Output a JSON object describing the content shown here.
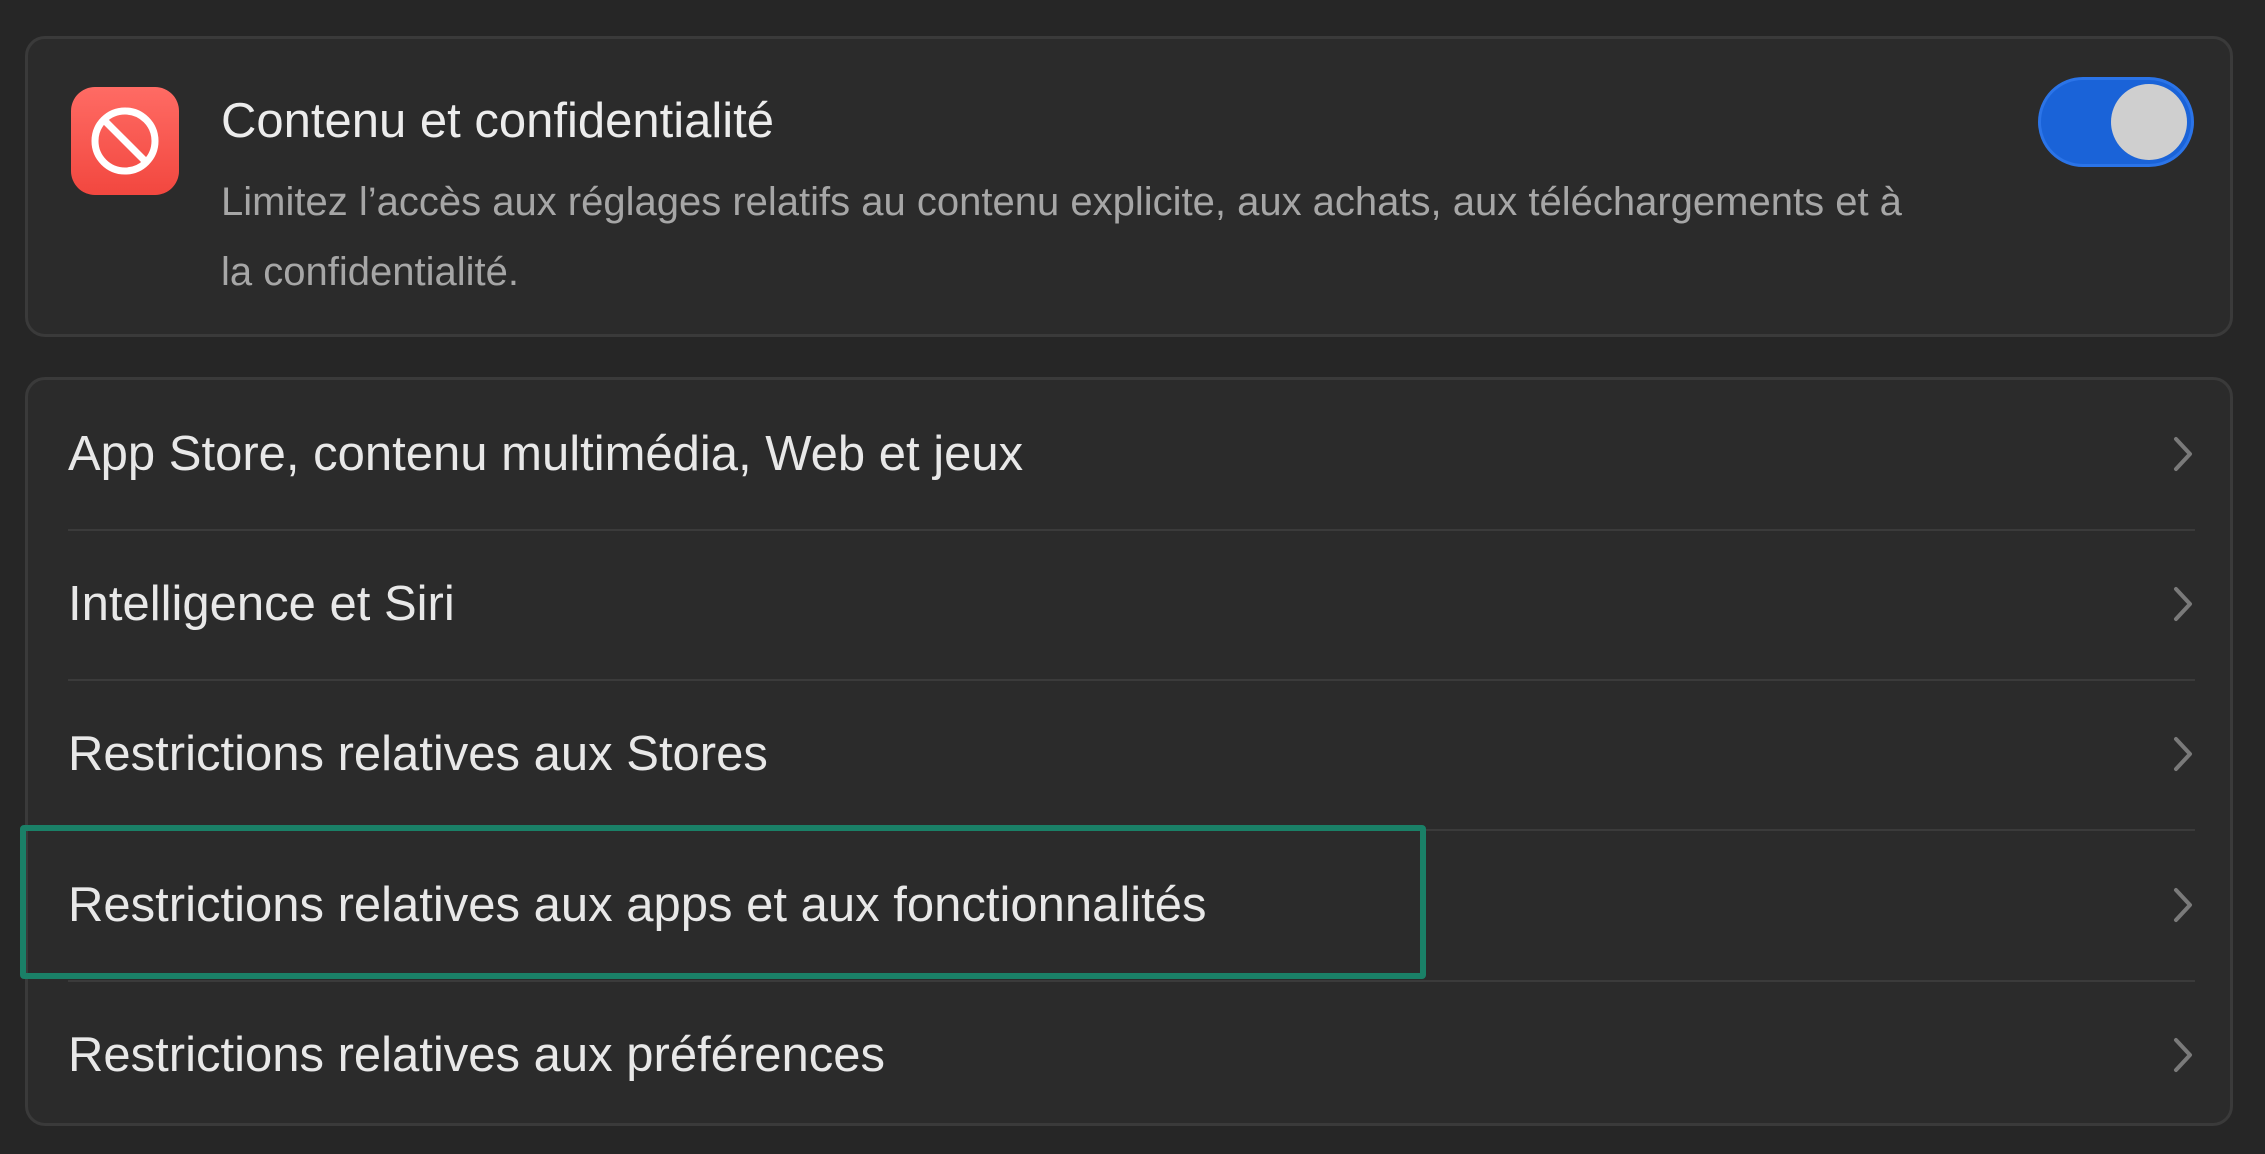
{
  "content_privacy": {
    "icon": "restricted-icon",
    "title": "Contenu et confidentialité",
    "description": "Limitez l’accès aux réglages relatifs au contenu explicite, aux achats, aux téléchargements et à la confidentialité.",
    "toggle_on": true,
    "toggle_color": "#1a63d8",
    "icon_color": "#f2473f"
  },
  "menu": {
    "items": [
      {
        "label": "App Store, contenu multimédia, Web et jeux"
      },
      {
        "label": "Intelligence et Siri"
      },
      {
        "label": "Restrictions relatives aux Stores"
      },
      {
        "label": "Restrictions relatives aux apps et aux fonctionnalités"
      },
      {
        "label": "Restrictions relatives aux préférences"
      }
    ]
  },
  "highlight_color": "#1a8067"
}
